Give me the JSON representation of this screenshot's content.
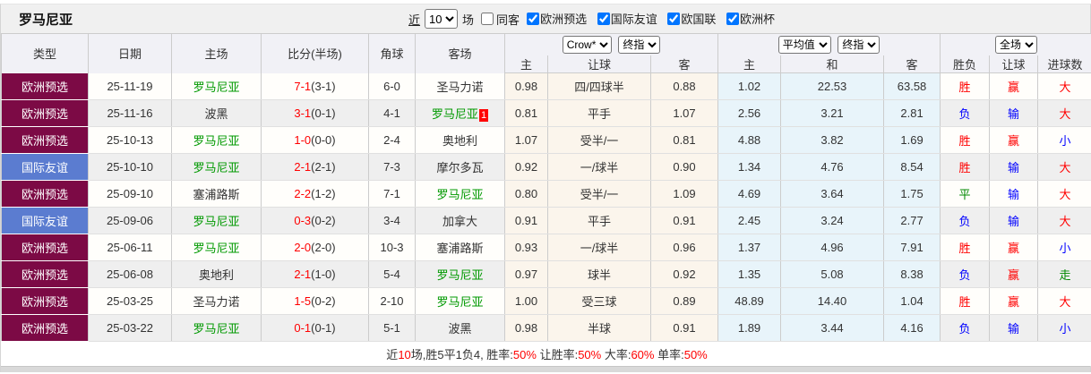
{
  "title": "罗马尼亚",
  "topbar": {
    "recent_label": "近",
    "recent_value": "10",
    "games_label": "场",
    "same_away": {
      "label": "同客",
      "checked": false
    },
    "filters": [
      {
        "label": "欧洲预选",
        "checked": true
      },
      {
        "label": "国际友谊",
        "checked": true
      },
      {
        "label": "欧国联",
        "checked": true
      },
      {
        "label": "欧洲杯",
        "checked": true
      }
    ]
  },
  "header": {
    "static_cols": [
      "类型",
      "日期",
      "主场",
      "比分(半场)",
      "角球",
      "客场"
    ],
    "asian_selects": [
      "Crow*",
      "终指"
    ],
    "euro_selects": [
      "平均值",
      "终指"
    ],
    "result_selects": [
      "全场"
    ],
    "sub_cols": [
      "主",
      "让球",
      "客",
      "主",
      "和",
      "客",
      "胜负",
      "让球",
      "进球数"
    ]
  },
  "colors": {
    "qual_badge": "#7c0a45",
    "friendly_badge": "#5b7cd0",
    "self_team_green": "#009900",
    "score_red": "#ff0000",
    "win_red": "#ff0000",
    "lose_blue": "#0000ff",
    "draw_green": "#008800",
    "asian_bg": "#fbf5ec",
    "euro_bg": "#e8f4fa"
  },
  "rows": [
    {
      "league": "欧洲预选",
      "league_type": "qual",
      "date": "25-11-19",
      "home": {
        "name": "罗马尼亚",
        "self": true,
        "badge": ""
      },
      "score_full": "7-1",
      "score_half": "(3-1)",
      "corner": "6-0",
      "away": {
        "name": "圣马力诺",
        "self": false,
        "badge": ""
      },
      "asian": [
        "0.98",
        "四/四球半",
        "0.88"
      ],
      "euro": [
        "1.02",
        "22.53",
        "63.58"
      ],
      "results": [
        {
          "t": "胜",
          "c": "win"
        },
        {
          "t": "赢",
          "c": "win"
        },
        {
          "t": "大",
          "c": "win"
        }
      ]
    },
    {
      "league": "欧洲预选",
      "league_type": "qual",
      "date": "25-11-16",
      "home": {
        "name": "波黑",
        "self": false,
        "badge": ""
      },
      "score_full": "3-1",
      "score_half": "(0-1)",
      "corner": "4-1",
      "away": {
        "name": "罗马尼亚",
        "self": true,
        "badge": "1"
      },
      "asian": [
        "0.81",
        "平手",
        "1.07"
      ],
      "euro": [
        "2.56",
        "3.21",
        "2.81"
      ],
      "results": [
        {
          "t": "负",
          "c": "lose"
        },
        {
          "t": "输",
          "c": "lose"
        },
        {
          "t": "大",
          "c": "win"
        }
      ]
    },
    {
      "league": "欧洲预选",
      "league_type": "qual",
      "date": "25-10-13",
      "home": {
        "name": "罗马尼亚",
        "self": true,
        "badge": ""
      },
      "score_full": "1-0",
      "score_half": "(0-0)",
      "corner": "2-4",
      "away": {
        "name": "奥地利",
        "self": false,
        "badge": ""
      },
      "asian": [
        "1.07",
        "受半/一",
        "0.81"
      ],
      "euro": [
        "4.88",
        "3.82",
        "1.69"
      ],
      "results": [
        {
          "t": "胜",
          "c": "win"
        },
        {
          "t": "赢",
          "c": "win"
        },
        {
          "t": "小",
          "c": "lose"
        }
      ]
    },
    {
      "league": "国际友谊",
      "league_type": "friendly",
      "date": "25-10-10",
      "home": {
        "name": "罗马尼亚",
        "self": true,
        "badge": ""
      },
      "score_full": "2-1",
      "score_half": "(2-1)",
      "corner": "7-3",
      "away": {
        "name": "摩尔多瓦",
        "self": false,
        "badge": ""
      },
      "asian": [
        "0.92",
        "一/球半",
        "0.90"
      ],
      "euro": [
        "1.34",
        "4.76",
        "8.54"
      ],
      "results": [
        {
          "t": "胜",
          "c": "win"
        },
        {
          "t": "输",
          "c": "lose"
        },
        {
          "t": "大",
          "c": "win"
        }
      ]
    },
    {
      "league": "欧洲预选",
      "league_type": "qual",
      "date": "25-09-10",
      "home": {
        "name": "塞浦路斯",
        "self": false,
        "badge": ""
      },
      "score_full": "2-2",
      "score_half": "(1-2)",
      "corner": "7-1",
      "away": {
        "name": "罗马尼亚",
        "self": true,
        "badge": ""
      },
      "asian": [
        "0.80",
        "受半/一",
        "1.09"
      ],
      "euro": [
        "4.69",
        "3.64",
        "1.75"
      ],
      "results": [
        {
          "t": "平",
          "c": "draw"
        },
        {
          "t": "输",
          "c": "lose"
        },
        {
          "t": "大",
          "c": "win"
        }
      ]
    },
    {
      "league": "国际友谊",
      "league_type": "friendly",
      "date": "25-09-06",
      "home": {
        "name": "罗马尼亚",
        "self": true,
        "badge": ""
      },
      "score_full": "0-3",
      "score_half": "(0-2)",
      "corner": "3-4",
      "away": {
        "name": "加拿大",
        "self": false,
        "badge": ""
      },
      "asian": [
        "0.91",
        "平手",
        "0.91"
      ],
      "euro": [
        "2.45",
        "3.24",
        "2.77"
      ],
      "results": [
        {
          "t": "负",
          "c": "lose"
        },
        {
          "t": "输",
          "c": "lose"
        },
        {
          "t": "大",
          "c": "win"
        }
      ]
    },
    {
      "league": "欧洲预选",
      "league_type": "qual",
      "date": "25-06-11",
      "home": {
        "name": "罗马尼亚",
        "self": true,
        "badge": ""
      },
      "score_full": "2-0",
      "score_half": "(2-0)",
      "corner": "10-3",
      "away": {
        "name": "塞浦路斯",
        "self": false,
        "badge": ""
      },
      "asian": [
        "0.93",
        "一/球半",
        "0.96"
      ],
      "euro": [
        "1.37",
        "4.96",
        "7.91"
      ],
      "results": [
        {
          "t": "胜",
          "c": "win"
        },
        {
          "t": "赢",
          "c": "win"
        },
        {
          "t": "小",
          "c": "lose"
        }
      ]
    },
    {
      "league": "欧洲预选",
      "league_type": "qual",
      "date": "25-06-08",
      "home": {
        "name": "奥地利",
        "self": false,
        "badge": ""
      },
      "score_full": "2-1",
      "score_half": "(1-0)",
      "corner": "5-4",
      "away": {
        "name": "罗马尼亚",
        "self": true,
        "badge": ""
      },
      "asian": [
        "0.97",
        "球半",
        "0.92"
      ],
      "euro": [
        "1.35",
        "5.08",
        "8.38"
      ],
      "results": [
        {
          "t": "负",
          "c": "lose"
        },
        {
          "t": "赢",
          "c": "win"
        },
        {
          "t": "走",
          "c": "draw"
        }
      ]
    },
    {
      "league": "欧洲预选",
      "league_type": "qual",
      "date": "25-03-25",
      "home": {
        "name": "圣马力诺",
        "self": false,
        "badge": ""
      },
      "score_full": "1-5",
      "score_half": "(0-2)",
      "corner": "2-10",
      "away": {
        "name": "罗马尼亚",
        "self": true,
        "badge": ""
      },
      "asian": [
        "1.00",
        "受三球",
        "0.89"
      ],
      "euro": [
        "48.89",
        "14.40",
        "1.04"
      ],
      "results": [
        {
          "t": "胜",
          "c": "win"
        },
        {
          "t": "赢",
          "c": "win"
        },
        {
          "t": "大",
          "c": "win"
        }
      ]
    },
    {
      "league": "欧洲预选",
      "league_type": "qual",
      "date": "25-03-22",
      "home": {
        "name": "罗马尼亚",
        "self": true,
        "badge": ""
      },
      "score_full": "0-1",
      "score_half": "(0-1)",
      "corner": "5-1",
      "away": {
        "name": "波黑",
        "self": false,
        "badge": ""
      },
      "asian": [
        "0.98",
        "半球",
        "0.91"
      ],
      "euro": [
        "1.89",
        "3.44",
        "4.16"
      ],
      "results": [
        {
          "t": "负",
          "c": "lose"
        },
        {
          "t": "输",
          "c": "lose"
        },
        {
          "t": "小",
          "c": "lose"
        }
      ]
    }
  ],
  "footer": {
    "segments": [
      {
        "text": "近",
        "c": "k"
      },
      {
        "text": "10",
        "c": "r"
      },
      {
        "text": "场,胜5平1负4, 胜率:",
        "c": "k"
      },
      {
        "text": "50%",
        "c": "r"
      },
      {
        "text": " 让胜率:",
        "c": "k"
      },
      {
        "text": "50%",
        "c": "r"
      },
      {
        "text": " 大率:",
        "c": "k"
      },
      {
        "text": "60%",
        "c": "r"
      },
      {
        "text": " 单率:",
        "c": "k"
      },
      {
        "text": "50%",
        "c": "r"
      }
    ]
  }
}
